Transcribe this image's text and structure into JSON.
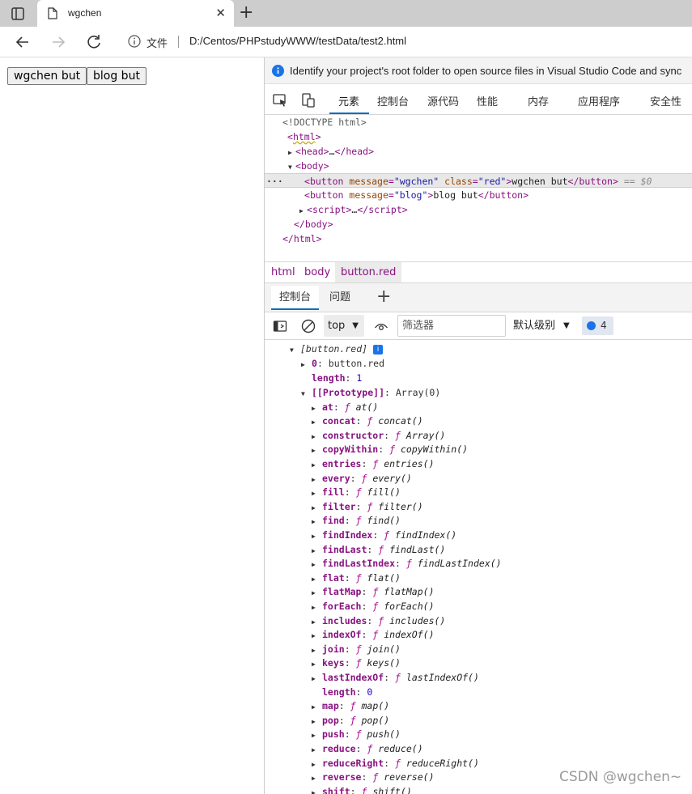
{
  "browser": {
    "tab_title": "wgchen",
    "tab_close": "✕",
    "new_tab": "+",
    "scheme_label": "文件",
    "url": "D:/Centos/PHPstudyWWW/testData/test2.html"
  },
  "page": {
    "buttons": [
      "wgchen but",
      "blog but"
    ]
  },
  "devtools": {
    "infobar_text": "Identify your project's root folder to open source files in Visual Studio Code and sync",
    "tabs": [
      "元素",
      "控制台",
      "源代码",
      "性能",
      "内存",
      "应用程序",
      "安全性"
    ],
    "active_tab": "元素",
    "elements": {
      "doctype": "<!DOCTYPE html>",
      "html_open": "html",
      "head": "head",
      "body": "body",
      "btn1": {
        "tag": "button",
        "attr1": "message",
        "val1": "\"wgchen\"",
        "attr2": "class",
        "val2": "\"red\"",
        "text": "wgchen but",
        "eq": "== $0"
      },
      "btn2": {
        "tag": "button",
        "attr1": "message",
        "val1": "\"blog\"",
        "text": "blog but"
      },
      "script": "script",
      "ellipsis": "…",
      "dots": "···"
    },
    "breadcrumbs": [
      "html",
      "body",
      "button.red"
    ],
    "drawer_tabs": [
      "控制台",
      "问题"
    ],
    "drawer_add": "+",
    "console_toolbar": {
      "context": "top",
      "filter_placeholder": "筛选器",
      "level": "默认级别",
      "issues_count": "4"
    },
    "console": {
      "header": "[button.red]",
      "item0_key": "0",
      "item0_val": "button.red",
      "length_key": "length",
      "length_val": "1",
      "proto_key": "[[Prototype]]",
      "proto_val": "Array(0)",
      "methods": [
        {
          "k": "at",
          "f": "at()"
        },
        {
          "k": "concat",
          "f": "concat()"
        },
        {
          "k": "constructor",
          "f": "Array()"
        },
        {
          "k": "copyWithin",
          "f": "copyWithin()"
        },
        {
          "k": "entries",
          "f": "entries()"
        },
        {
          "k": "every",
          "f": "every()"
        },
        {
          "k": "fill",
          "f": "fill()"
        },
        {
          "k": "filter",
          "f": "filter()"
        },
        {
          "k": "find",
          "f": "find()"
        },
        {
          "k": "findIndex",
          "f": "findIndex()"
        },
        {
          "k": "findLast",
          "f": "findLast()"
        },
        {
          "k": "findLastIndex",
          "f": "findLastIndex()"
        },
        {
          "k": "flat",
          "f": "flat()"
        },
        {
          "k": "flatMap",
          "f": "flatMap()"
        },
        {
          "k": "forEach",
          "f": "forEach()"
        },
        {
          "k": "includes",
          "f": "includes()"
        },
        {
          "k": "indexOf",
          "f": "indexOf()"
        },
        {
          "k": "join",
          "f": "join()"
        },
        {
          "k": "keys",
          "f": "keys()"
        },
        {
          "k": "lastIndexOf",
          "f": "lastIndexOf()"
        },
        {
          "k": "length",
          "v": "0"
        },
        {
          "k": "map",
          "f": "map()"
        },
        {
          "k": "pop",
          "f": "pop()"
        },
        {
          "k": "push",
          "f": "push()"
        },
        {
          "k": "reduce",
          "f": "reduce()"
        },
        {
          "k": "reduceRight",
          "f": "reduceRight()"
        },
        {
          "k": "reverse",
          "f": "reverse()"
        },
        {
          "k": "shift",
          "f": "shift()"
        }
      ]
    }
  },
  "watermark": "CSDN @wgchen~",
  "colors": {
    "accent": "#0f6cbd",
    "tag": "#881280",
    "attr": "#994500",
    "value": "#1a1aa6"
  }
}
